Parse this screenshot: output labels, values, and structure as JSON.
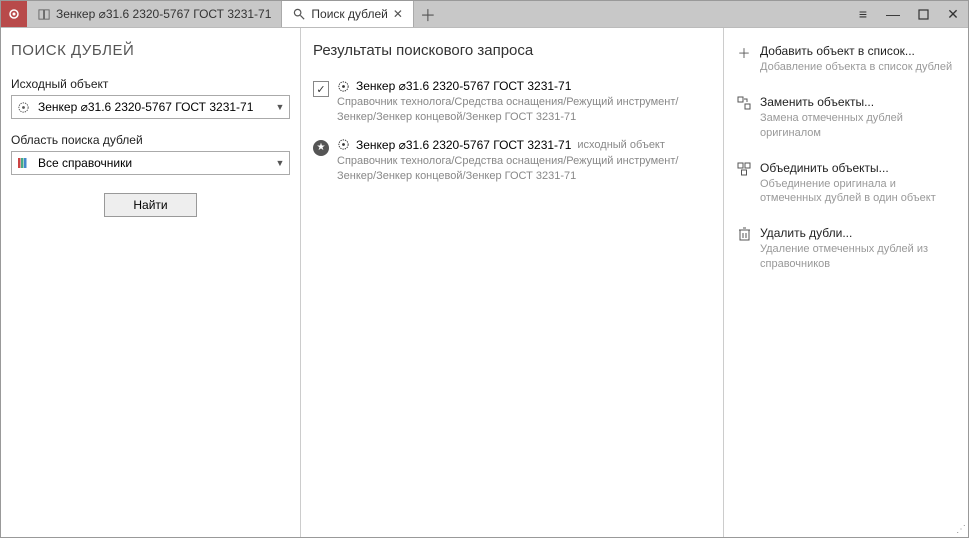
{
  "tabs": [
    {
      "label": "Зенкер ⌀31.6 2320-5767 ГОСТ 3231-71",
      "active": false,
      "closable": false
    },
    {
      "label": "Поиск дублей",
      "active": true,
      "closable": true
    }
  ],
  "left": {
    "heading": "ПОИСК ДУБЛЕЙ",
    "source_label": "Исходный объект",
    "source_value": "Зенкер ⌀31.6 2320-5767 ГОСТ 3231-71",
    "scope_label": "Область поиска дублей",
    "scope_value": "Все справочники",
    "find_button": "Найти"
  },
  "center": {
    "heading": "Результаты поискового запроса",
    "results": [
      {
        "checked": true,
        "is_source": false,
        "title": "Зенкер ⌀31.6 2320-5767 ГОСТ 3231-71",
        "suffix": "",
        "path": "Справочник технолога/Средства оснащения/Режущий инструмент/Зенкер/Зенкер концевой/Зенкер ГОСТ 3231-71"
      },
      {
        "checked": false,
        "is_source": true,
        "title": "Зенкер ⌀31.6 2320-5767 ГОСТ 3231-71",
        "suffix": "исходный объект",
        "path": "Справочник технолога/Средства оснащения/Режущий инструмент/Зенкер/Зенкер концевой/Зенкер ГОСТ 3231-71"
      }
    ]
  },
  "right": {
    "actions": [
      {
        "icon": "plus",
        "title": "Добавить объект в список...",
        "desc": "Добавление объекта в список дублей"
      },
      {
        "icon": "replace",
        "title": "Заменить объекты...",
        "desc": "Замена отмеченных дублей оригиналом"
      },
      {
        "icon": "merge",
        "title": "Объединить объекты...",
        "desc": "Объединение оригинала и отмеченных дублей в один объект"
      },
      {
        "icon": "trash",
        "title": "Удалить дубли...",
        "desc": "Удаление отмеченных дублей из справочников"
      }
    ]
  }
}
